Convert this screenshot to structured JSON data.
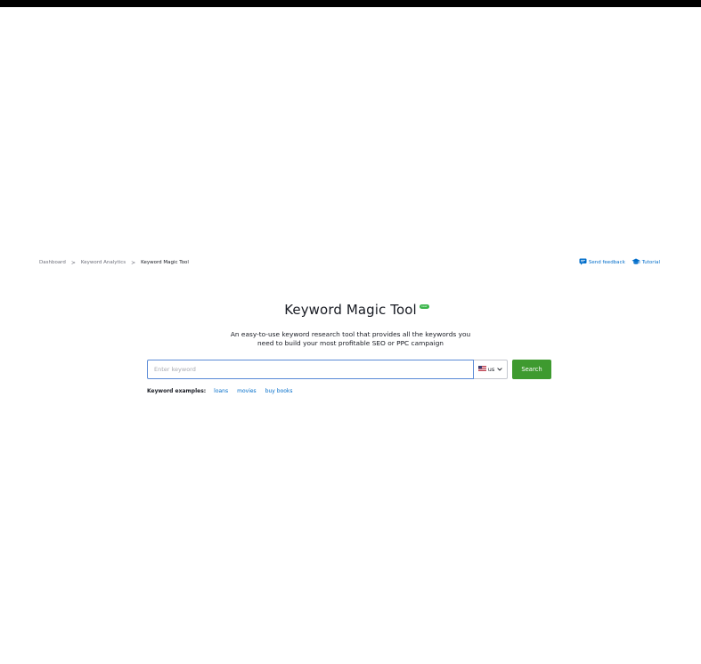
{
  "breadcrumb": {
    "items": [
      {
        "label": "Dashboard"
      },
      {
        "label": "Keyword Analytics"
      },
      {
        "label": "Keyword Magic Tool"
      }
    ],
    "separator": ">"
  },
  "top_actions": {
    "feedback_label": "Send feedback",
    "feedback_icon": "chat-bubble-icon",
    "tutorial_label": "Tutorial",
    "tutorial_icon": "graduation-cap-icon"
  },
  "header": {
    "title": "Keyword Magic Tool",
    "badge": "new",
    "subtitle_line1": "An easy-to-use keyword research tool that provides all the keywords you",
    "subtitle_line2": "need to build your most profitable SEO or PPC campaign"
  },
  "search": {
    "placeholder": "Enter keyword",
    "value": "",
    "database": "us",
    "database_icon": "us-flag-icon",
    "button_label": "Search"
  },
  "examples": {
    "label": "Keyword examples:",
    "items": [
      "loans",
      "movies",
      "buy books"
    ]
  },
  "colors": {
    "accent_link": "#006dca",
    "search_button": "#3e9a2f",
    "badge": "#3ab54a",
    "input_focus_border": "#5a8ad6"
  }
}
